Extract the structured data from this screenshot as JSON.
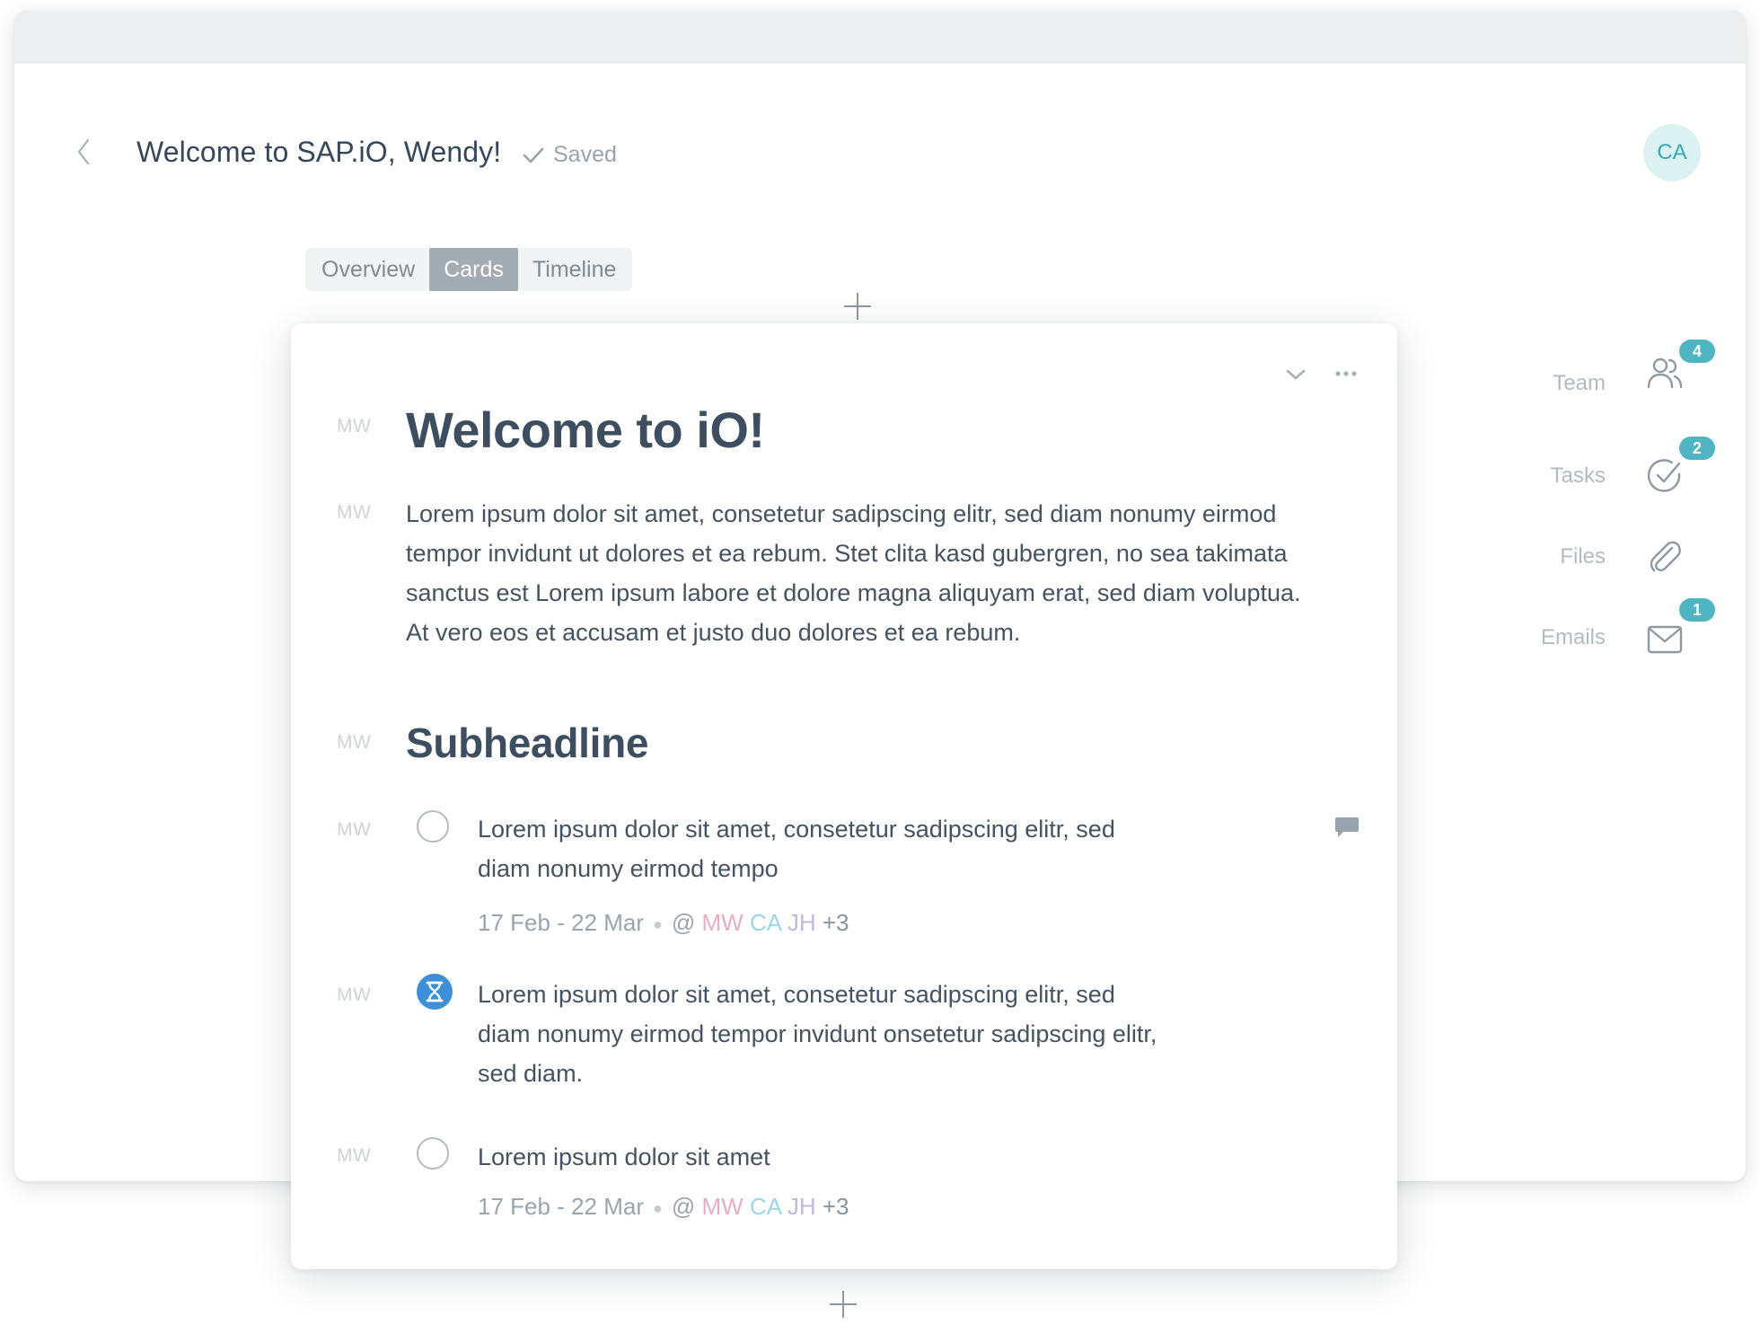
{
  "header": {
    "title": "Welcome to SAP.iO, Wendy!",
    "saved_label": "Saved",
    "avatar_initials": "CA"
  },
  "tabs": [
    {
      "label": "Overview",
      "active": false
    },
    {
      "label": "Cards",
      "active": true
    },
    {
      "label": "Timeline",
      "active": false
    }
  ],
  "rail": [
    {
      "label": "Team",
      "icon": "team-icon",
      "badge": "4"
    },
    {
      "label": "Tasks",
      "icon": "tasks-icon",
      "badge": "2"
    },
    {
      "label": "Files",
      "icon": "paperclip-icon",
      "badge": ""
    },
    {
      "label": "Emails",
      "icon": "mail-icon",
      "badge": "1"
    }
  ],
  "card": {
    "title": "Welcome to iO!",
    "title_author": "MW",
    "paragraph": "Lorem ipsum dolor sit amet, consetetur sadipscing elitr, sed diam nonumy eirmod tempor invidunt ut dolores et ea rebum. Stet clita kasd gubergren, no sea takimata sanctus est Lorem ipsum labore et dolore magna aliquyam erat, sed diam voluptua. At vero eos et accusam et justo duo dolores et ea rebum.",
    "paragraph_author": "MW",
    "subheadline": "Subheadline",
    "subheadline_author": "MW",
    "tasks": [
      {
        "author": "MW",
        "status": "open",
        "text": "Lorem ipsum dolor sit amet, consetetur sadipscing elitr, sed diam nonumy eirmod tempo",
        "dates": "17 Feb - 22 Mar",
        "at": "@",
        "assignees": [
          "MW",
          "CA",
          "JH"
        ],
        "more": "+3"
      },
      {
        "author": "MW",
        "status": "in-progress",
        "text": "Lorem ipsum dolor sit amet, consetetur sadipscing elitr, sed diam nonumy eirmod tempor invidunt onsetetur sadipscing elitr, sed diam."
      },
      {
        "author": "MW",
        "status": "open",
        "text": "Lorem ipsum dolor sit amet",
        "dates": "17 Feb - 22 Mar",
        "at": "@",
        "assignees": [
          "MW",
          "CA",
          "JH"
        ],
        "more": "+3"
      }
    ]
  },
  "colors": {
    "accent": "#4fb5c2",
    "progress": "#3d8fd8",
    "active_tab": "#a3abb3",
    "title_text": "#3d4e60"
  }
}
